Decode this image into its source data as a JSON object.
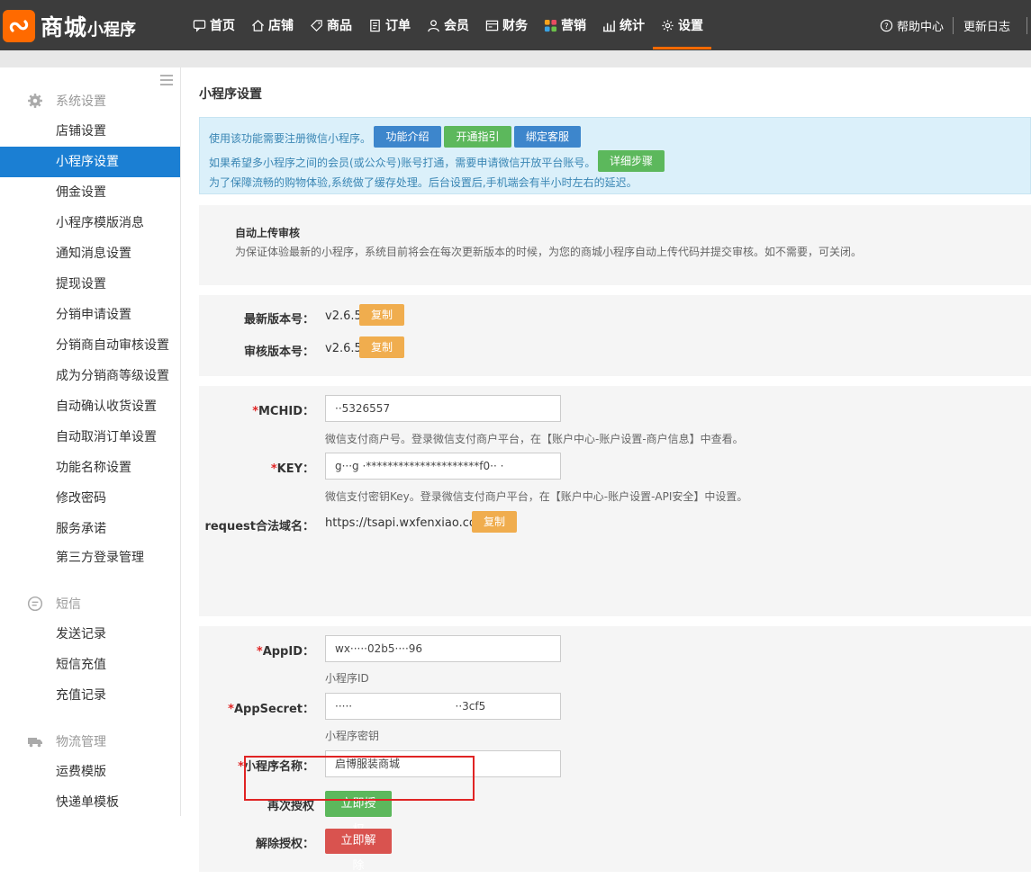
{
  "app": {
    "logo_main": "商城",
    "logo_sub": "小程序"
  },
  "nav": [
    {
      "label": "首页",
      "icon": "chat-icon"
    },
    {
      "label": "店铺",
      "icon": "home-icon"
    },
    {
      "label": "商品",
      "icon": "tag-icon"
    },
    {
      "label": "订单",
      "icon": "document-icon"
    },
    {
      "label": "会员",
      "icon": "user-icon"
    },
    {
      "label": "财务",
      "icon": "finance-icon"
    },
    {
      "label": "营销",
      "icon": "marketing-icon"
    },
    {
      "label": "统计",
      "icon": "bar-chart-icon"
    },
    {
      "label": "设置",
      "icon": "gear-icon",
      "active": true
    }
  ],
  "topright": {
    "help": "帮助中心",
    "changelog": "更新日志"
  },
  "sidebar": {
    "groups": [
      {
        "label": "系统设置",
        "icon": "gear-icon"
      },
      {
        "label": "短信",
        "icon": "message-icon"
      },
      {
        "label": "物流管理",
        "icon": "truck-icon"
      }
    ],
    "items": [
      "店铺设置",
      "小程序设置",
      "佣金设置",
      "小程序模版消息",
      "通知消息设置",
      "提现设置",
      "分销申请设置",
      "分销商自动审核设置",
      "成为分销商等级设置",
      "自动确认收货设置",
      "自动取消订单设置",
      "功能名称设置",
      "修改密码",
      "服务承诺",
      "第三方登录管理",
      "发送记录",
      "短信充值",
      "充值记录",
      "运费模版",
      "快递单模板"
    ],
    "active_item": "小程序设置"
  },
  "page": {
    "title": "小程序设置"
  },
  "notice": {
    "line1": "使用该功能需要注册微信小程序。",
    "btn_intro": "功能介绍",
    "btn_guide": "开通指引",
    "btn_service": "绑定客服",
    "line2": "如果希望多小程序之间的会员(或公众号)账号打通，需要申请微信开放平台账号。",
    "btn_steps": "详细步骤",
    "line3": "为了保障流畅的购物体验,系统做了缓存处理。后台设置后,手机端会有半小时左右的延迟。"
  },
  "auto_review": {
    "title": "自动上传审核",
    "desc": "为保证体验最新的小程序，系统目前将会在每次更新版本的时候，为您的商城小程序自动上传代码并提交审核。如不需要，可关闭。"
  },
  "versions": {
    "latest_label": "最新版本号：",
    "latest_value": "v2.6.5",
    "review_label": "审核版本号：",
    "review_value": "v2.6.5",
    "copy": "复制"
  },
  "payment": {
    "req": "*",
    "mchid_label": "MCHID：",
    "mchid_value": "··5326557",
    "mchid_hint": "微信支付商户号。登录微信支付商户平台，在【账户中心-账户设置-商户信息】中查看。",
    "key_label": "KEY：",
    "key_value": "g···g ·*********************f0··  ·",
    "key_hint": "微信支付密钥Key。登录微信支付商户平台，在【账户中心-账户设置-API安全】中设置。",
    "domain_label": "request合法域名：",
    "domain_value": "https://tsapi.wxfenxiao.com",
    "copy": "复制"
  },
  "app_config": {
    "req": "*",
    "appid_label": "AppID：",
    "appid_value": "wx·····02b5····96",
    "appid_hint": "小程序ID",
    "secret_label": "AppSecret：",
    "secret_value": "·····                              ··3cf5",
    "secret_hint": "小程序密钥",
    "name_label": "小程序名称：",
    "name_value": "启博服装商城",
    "reauth_label": "再次授权",
    "reauth_btn": "立即授权",
    "revoke_label": "解除授权：",
    "revoke_btn": "立即解除"
  },
  "colors": {
    "topbar": "#3c3c3c",
    "accent": "#ff6a00",
    "active": "#1b7fd3",
    "danger": "#d9534f"
  }
}
